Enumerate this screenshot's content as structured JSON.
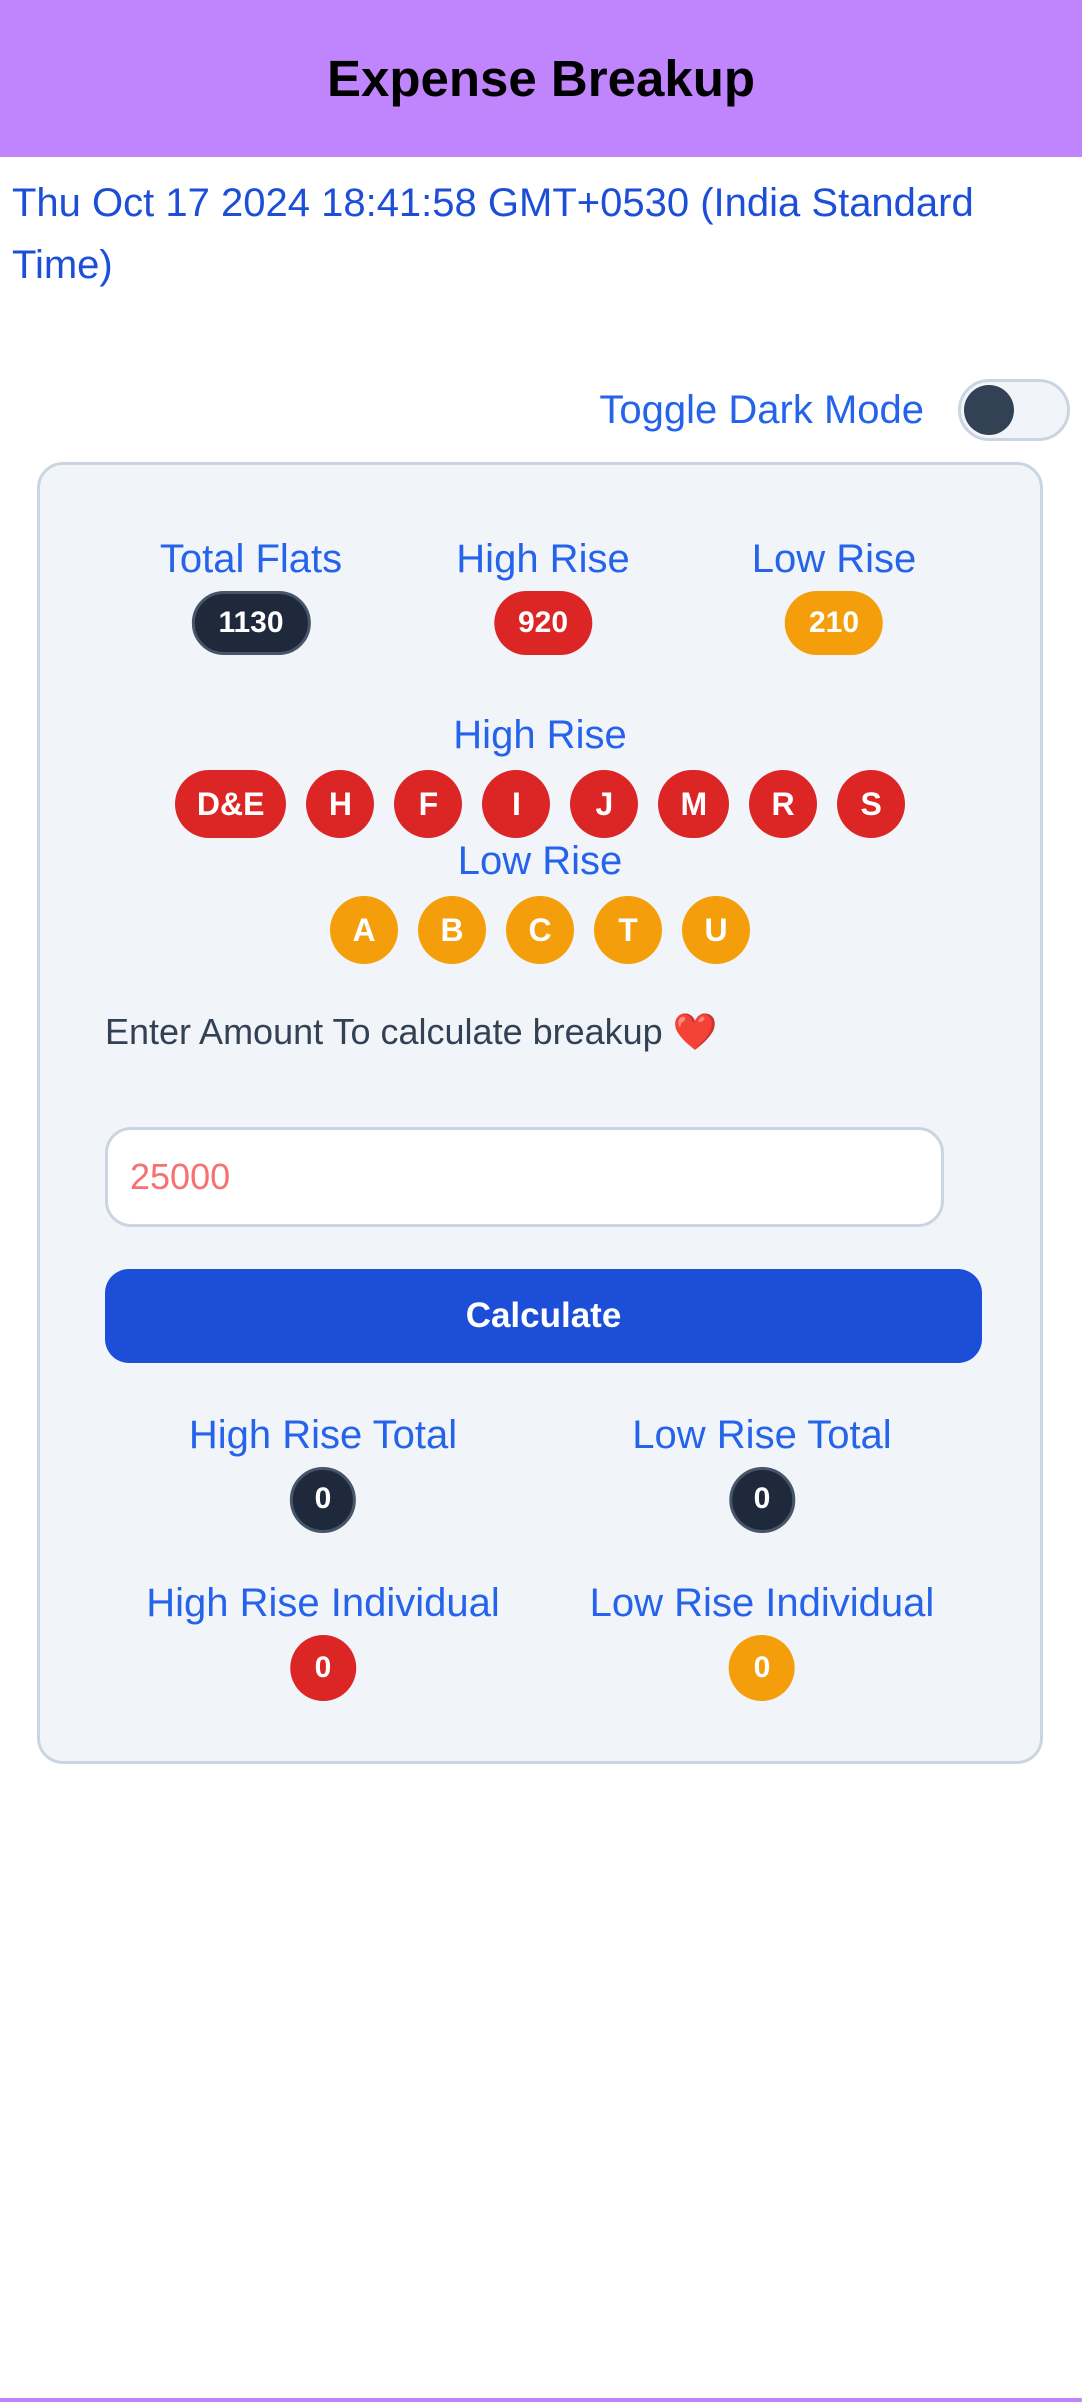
{
  "header": {
    "title": "Expense Breakup"
  },
  "datetime": "Thu Oct 17 2024 18:41:58 GMT+0530 (India Standard Time)",
  "toggle": {
    "label": "Toggle Dark Mode",
    "state": "off"
  },
  "stats": {
    "total_flats": {
      "label": "Total Flats",
      "value": "1130"
    },
    "high_rise": {
      "label": "High Rise",
      "value": "920"
    },
    "low_rise": {
      "label": "Low Rise",
      "value": "210"
    }
  },
  "wings": {
    "high_rise_title": "High Rise",
    "high_rise": [
      "D&E",
      "H",
      "F",
      "I",
      "J",
      "M",
      "R",
      "S"
    ],
    "low_rise_title": "Low Rise",
    "low_rise": [
      "A",
      "B",
      "C",
      "T",
      "U"
    ]
  },
  "calculator": {
    "prompt": "Enter Amount To calculate breakup",
    "heart": "❤️",
    "amount_placeholder": "25000",
    "button_label": "Calculate"
  },
  "results": {
    "high_rise_total": {
      "label": "High Rise Total",
      "value": "0"
    },
    "low_rise_total": {
      "label": "Low Rise Total",
      "value": "0"
    },
    "high_rise_individual": {
      "label": "High Rise Individual",
      "value": "0"
    },
    "low_rise_individual": {
      "label": "Low Rise Individual",
      "value": "0"
    }
  },
  "colors": {
    "header_bg": "#c084fc",
    "accent_blue": "#1d4ed8",
    "high_rise_red": "#dc2626",
    "low_rise_amber": "#f59e0b",
    "dark_badge": "#1e293b"
  }
}
